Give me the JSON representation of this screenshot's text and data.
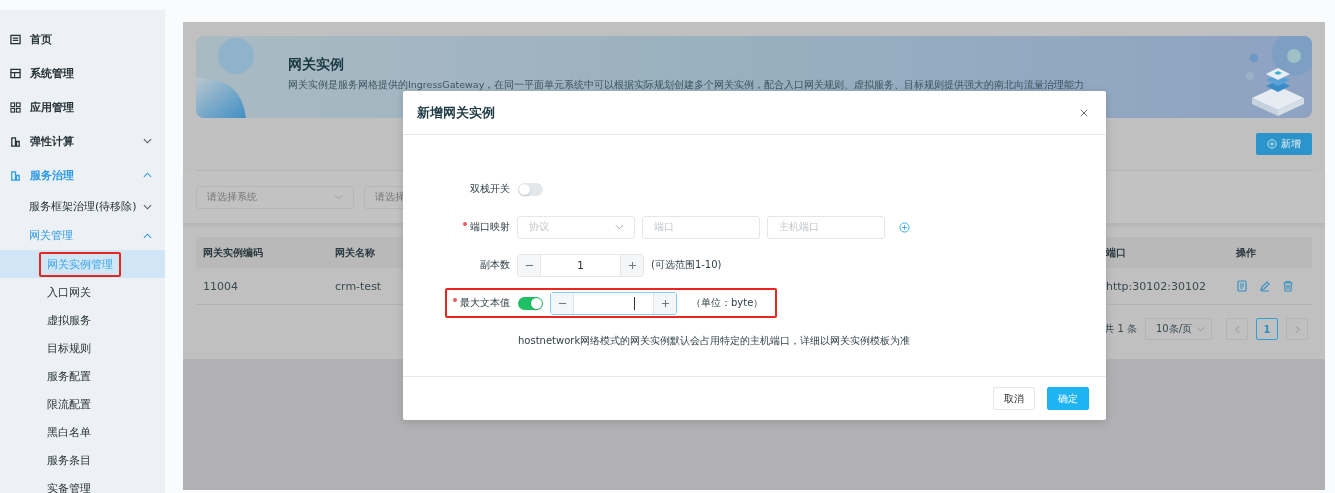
{
  "sidebar": {
    "items": [
      {
        "label": "首页",
        "selected": false,
        "highlighted": false
      },
      {
        "label": "系统管理",
        "selected": false,
        "highlighted": false
      },
      {
        "label": "应用管理",
        "selected": false,
        "highlighted": false
      },
      {
        "label": "弹性计算",
        "expanded": false,
        "selected": false,
        "highlighted": false
      },
      {
        "label": "服务治理",
        "expanded": true,
        "selected": false,
        "highlighted": false,
        "children": [
          {
            "label": "服务框架治理(待移除)",
            "expanded": false,
            "selected": false,
            "highlighted": false
          },
          {
            "label": "网关管理",
            "expanded": true,
            "selected": false,
            "highlighted": false,
            "children": [
              {
                "label": "网关实例管理",
                "selected": true,
                "highlighted": true
              },
              {
                "label": "入口网关",
                "selected": false,
                "highlighted": false
              },
              {
                "label": "虚拟服务",
                "selected": false,
                "highlighted": false
              },
              {
                "label": "目标规则",
                "selected": false,
                "highlighted": false
              },
              {
                "label": "服务配置",
                "selected": false,
                "highlighted": false
              },
              {
                "label": "限流配置",
                "selected": false,
                "highlighted": false
              },
              {
                "label": "黑白名单",
                "selected": false,
                "highlighted": false
              },
              {
                "label": "服务条目",
                "selected": false,
                "highlighted": false
              },
              {
                "label": "实备管理",
                "selected": false,
                "highlighted": false
              }
            ]
          }
        ]
      }
    ]
  },
  "banner": {
    "title": "网关实例",
    "description": "网关实例是服务网格提供的IngressGateway，在同一平面单元系统中可以根据实际规划创建多个网关实例，配合入口网关规则、虚拟服务、目标规则提供强大的南北向流量治理能力"
  },
  "toolbar": {
    "add_button": "新增"
  },
  "filters": [
    {
      "placeholder": "请选择系统"
    },
    {
      "placeholder": "请选择"
    }
  ],
  "table": {
    "columns": [
      "网关实例编码",
      "网关名称",
      "端口",
      "操作"
    ],
    "rows": [
      {
        "code": "11004",
        "name": "crm-test",
        "port": "http:30102:30102"
      }
    ]
  },
  "pagination": {
    "total": "共 1 条",
    "page_size": "10条/页",
    "pages": [
      {
        "label": "1",
        "selected": true
      }
    ]
  },
  "dialog": {
    "title": "新增网关实例",
    "fields": [
      {
        "kind": "switch",
        "label": "双栈开关",
        "required": false,
        "on": false,
        "highlighted": false
      },
      {
        "kind": "port_mapping",
        "label": "端口映射",
        "required": true,
        "highlighted": false,
        "inputs": [
          {
            "kind": "select",
            "placeholder": "协议"
          },
          {
            "kind": "input",
            "placeholder": "端口"
          },
          {
            "kind": "input",
            "placeholder": "主机端口"
          }
        ]
      },
      {
        "kind": "stepper",
        "label": "副本数",
        "required": false,
        "highlighted": false,
        "value": "1",
        "focused": false,
        "hint": "(可选范围1-10)"
      },
      {
        "kind": "switch_stepper",
        "label": "最大文本值",
        "required": true,
        "highlighted": true,
        "on": true,
        "focused": true,
        "hint": "（单位：byte）"
      }
    ],
    "note": "hostnetwork网络模式的网关实例默认会占用特定的主机端口，详细以网关实例模板为准",
    "buttons": [
      {
        "label": "取消",
        "kind": "default"
      },
      {
        "label": "确定",
        "kind": "primary"
      }
    ]
  }
}
